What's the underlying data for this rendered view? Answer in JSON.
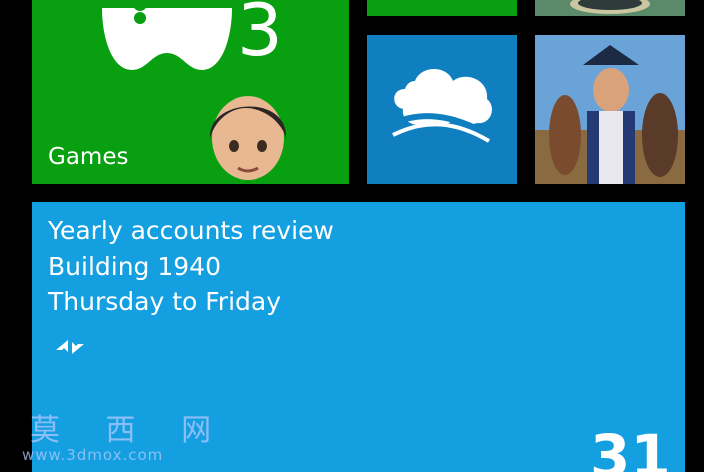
{
  "start_screen": {
    "games_tile": {
      "label": "Games",
      "badge": "3",
      "icon": "xbox-controller-icon",
      "color": "#089f10"
    },
    "skydrive_tile": {
      "icon": "cloud-icon",
      "color": "#0f7fc0"
    },
    "calendar_tile": {
      "title": "Yearly accounts review",
      "location": "Building 1940",
      "time": "Thursday to Friday",
      "day": "31",
      "icon": "compress-arrows-icon",
      "color": "#139fe0"
    }
  },
  "watermark": {
    "text": "莫 西 网",
    "url": "www.3dmox.com"
  }
}
